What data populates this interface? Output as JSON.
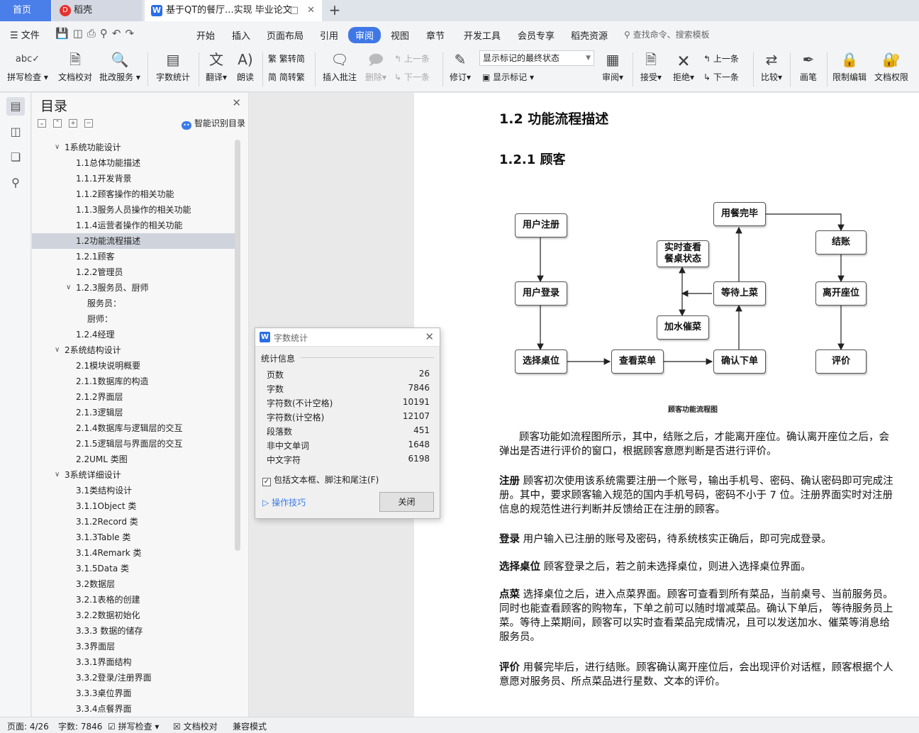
{
  "tabs": {
    "home": "首页",
    "daoke": "稻壳",
    "doc_title": "基于QT的餐厅...实现 毕业论文",
    "add": "+"
  },
  "menu": {
    "file": "文件",
    "items": [
      "开始",
      "插入",
      "页面布局",
      "引用",
      "审阅",
      "视图",
      "章节",
      "开发工具",
      "会员专享",
      "稻壳资源"
    ],
    "active": "审阅",
    "search": "查找命令、搜索模板"
  },
  "ribbon": {
    "spell_check": "拼写检查",
    "doc_proof": "文档校对",
    "correction_service": "批改服务",
    "word_count": "字数统计",
    "translate": "翻译",
    "read_aloud": "朗读",
    "trad_to_simp": "繁转简",
    "simp_to_trad": "简转繁",
    "insert_comment": "插入批注",
    "delete": "删除",
    "prev_comment": "上一条",
    "next_comment": "下一条",
    "track_changes": "修订",
    "markup_select": "显示标记的最终状态",
    "show_markup": "显示标记",
    "review": "审阅",
    "accept": "接受",
    "reject": "拒绝",
    "prev_change": "上一条",
    "next_change": "下一条",
    "compare": "比较",
    "pen": "画笔",
    "restrict_edit": "限制编辑",
    "doc_permission": "文档权限"
  },
  "toc": {
    "title": "目录",
    "smart_toc": "智能识别目录",
    "items": [
      {
        "label": "1系统功能设计",
        "level": 1,
        "expanded": true
      },
      {
        "label": "1.1总体功能描述",
        "level": 2
      },
      {
        "label": "1.1.1开发背景",
        "level": 2
      },
      {
        "label": "1.1.2顾客操作的相关功能",
        "level": 2
      },
      {
        "label": "1.1.3服务人员操作的相关功能",
        "level": 2
      },
      {
        "label": "1.1.4运营者操作的相关功能",
        "level": 2
      },
      {
        "label": "1.2功能流程描述",
        "level": 2,
        "selected": true
      },
      {
        "label": "1.2.1顾客",
        "level": 2
      },
      {
        "label": "1.2.2管理员",
        "level": 2
      },
      {
        "label": "1.2.3服务员、厨师",
        "level": 2,
        "expanded": true
      },
      {
        "label": "服务员：",
        "level": 3
      },
      {
        "label": "厨师：",
        "level": 3
      },
      {
        "label": "1.2.4经理",
        "level": 2
      },
      {
        "label": "2系统结构设计",
        "level": 1,
        "expanded": true
      },
      {
        "label": "2.1模块说明概要",
        "level": 2
      },
      {
        "label": "2.1.1数据库的构造",
        "level": 2
      },
      {
        "label": "2.1.2界面层",
        "level": 2
      },
      {
        "label": "2.1.3逻辑层",
        "level": 2
      },
      {
        "label": "2.1.4数据库与逻辑层的交互",
        "level": 2
      },
      {
        "label": "2.1.5逻辑层与界面层的交互",
        "level": 2
      },
      {
        "label": "2.2UML 类图",
        "level": 2
      },
      {
        "label": "3系统详细设计",
        "level": 1,
        "expanded": true
      },
      {
        "label": "3.1类结构设计",
        "level": 2
      },
      {
        "label": "3.1.1Object 类",
        "level": 2
      },
      {
        "label": "3.1.2Record 类",
        "level": 2
      },
      {
        "label": "3.1.3Table 类",
        "level": 2
      },
      {
        "label": "3.1.4Remark 类",
        "level": 2
      },
      {
        "label": "3.1.5Data 类",
        "level": 2
      },
      {
        "label": "3.2数据层",
        "level": 2
      },
      {
        "label": "3.2.1表格的创建",
        "level": 2
      },
      {
        "label": "3.2.2数据初始化",
        "level": 2
      },
      {
        "label": "3.3.3 数据的储存",
        "level": 2
      },
      {
        "label": "3.3界面层",
        "level": 2
      },
      {
        "label": "3.3.1界面结构",
        "level": 2
      },
      {
        "label": "3.3.2登录/注册界面",
        "level": 2
      },
      {
        "label": "3.3.3桌位界面",
        "level": 2
      },
      {
        "label": "3.3.4点餐界面",
        "level": 2
      }
    ]
  },
  "doc": {
    "h2": "1.2  功能流程描述",
    "h3": "1.2.1   顾客",
    "flow": {
      "register": "用户注册",
      "login": "用户登录",
      "choose_table": "选择桌位",
      "view_menu": "查看菜单",
      "confirm_order": "确认下单",
      "wait_serve": "等待上菜",
      "realtime_line1": "实时查看",
      "realtime_line2": "餐桌状态",
      "add_water": "加水催菜",
      "meal_done": "用餐完毕",
      "checkout": "结账",
      "leave": "离开座位",
      "rate": "评价",
      "caption": "顾客功能流程图"
    },
    "paragraphs": [
      {
        "key": "",
        "text": "顾客功能如流程图所示，其中，结账之后，才能离开座位。确认离开座位之后，会弹出是否进行评价的窗口，根据顾客意愿判断是否进行评价。"
      },
      {
        "key": "注册",
        "text": "顾客初次使用该系统需要注册一个账号，输出手机号、密码、确认密码即可完成注册。其中，要求顾客输入规范的国内手机号码，密码不小于 7 位。注册界面实时对注册信息的规范性进行判断并反馈给正在注册的顾客。"
      },
      {
        "key": "登录",
        "text": "用户输入已注册的账号及密码，待系统核实正确后，即可完成登录。"
      },
      {
        "key": "选择桌位",
        "text": "顾客登录之后，若之前未选择桌位，则进入选择桌位界面。"
      },
      {
        "key": "点菜",
        "text": "选择桌位之后，进入点菜界面。顾客可查看到所有菜品，当前桌号、当前服务员。同时也能查看顾客的购物车，下单之前可以随时增减菜品。确认下单后， 等待服务员上菜。等待上菜期间，顾客可以实时查看菜品完成情况，且可以发送加水、催菜等消息给服务员。"
      },
      {
        "key": "评价",
        "text": "用餐完毕后，进行结账。顾客确认离开座位后，会出现评价对话框，顾客根据个人意愿对服务员、所点菜品进行星数、文本的评价。"
      }
    ]
  },
  "word_count_dialog": {
    "title": "字数统计",
    "section": "统计信息",
    "rows": [
      {
        "label": "页数",
        "value": "26"
      },
      {
        "label": "字数",
        "value": "7846"
      },
      {
        "label": "字符数(不计空格)",
        "value": "10191"
      },
      {
        "label": "字符数(计空格)",
        "value": "12107"
      },
      {
        "label": "段落数",
        "value": "451"
      },
      {
        "label": "非中文单词",
        "value": "1648"
      },
      {
        "label": "中文字符",
        "value": "6198"
      }
    ],
    "include_label": "包括文本框、脚注和尾注(F)",
    "include_checked": true,
    "tips": "操作技巧",
    "close": "关闭"
  },
  "status": {
    "page": "页面: 4/26",
    "words": "字数: 7846",
    "spell_check": "拼写检查",
    "doc_proof": "文档校对",
    "compat_mode": "兼容模式"
  },
  "colors": {
    "accent": "#3f78e6",
    "home_tab": "#4a7ee8",
    "selected_toc": "#cfd3dc"
  }
}
